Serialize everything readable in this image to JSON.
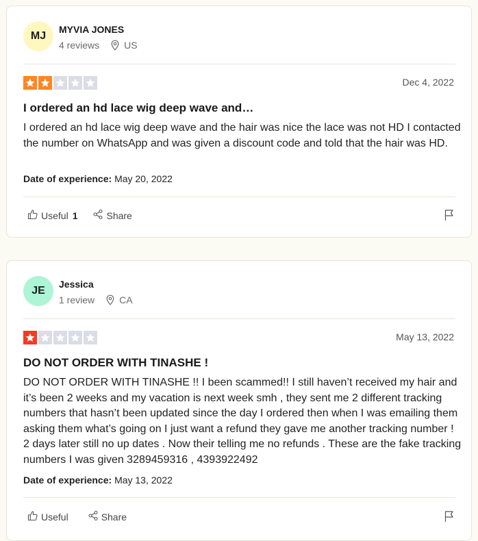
{
  "colors": {
    "star_orange": "#ff8622",
    "star_red": "#ff3722",
    "star_empty": "#dcdce6",
    "avatar_yellow": "#fff7bf",
    "avatar_green": "#aef4d6"
  },
  "reviews": [
    {
      "avatar_initials": "MJ",
      "name": "MYVIA JONES",
      "review_count": "4 reviews",
      "country": "US",
      "rating": 2,
      "date": "Dec 4, 2022",
      "title": "I ordered an hd lace wig deep wave and…",
      "body": "I ordered an hd lace wig deep wave and the hair was nice the lace was not HD I contacted the number on WhatsApp and was given a discount code and told that the hair was HD.",
      "date_label": "Date of experience:",
      "date_of_experience": "May 20, 2022",
      "useful_label": "Useful",
      "useful_count": "1",
      "share_label": "Share"
    },
    {
      "avatar_initials": "JE",
      "name": "Jessica",
      "review_count": "1 review",
      "country": "CA",
      "rating": 1,
      "date": "May 13, 2022",
      "title": "DO NOT ORDER WITH TINASHE !",
      "body": "DO NOT ORDER WITH TINASHE !! I been scammed!! I still haven’t received my hair and it’s been 2 weeks and my vacation is next week smh , they sent me 2 different tracking numbers that hasn’t been updated since the day I ordered then when I was emailing them asking them what’s going on I just want a refund they gave me another tracking number ! 2 days later still no up dates . Now their telling me no refunds . These are the fake tracking numbers I was given 3289459316 , 4393922492",
      "date_label": "Date of experience:",
      "date_of_experience": "May 13, 2022",
      "useful_label": "Useful",
      "useful_count": "",
      "share_label": "Share"
    }
  ]
}
